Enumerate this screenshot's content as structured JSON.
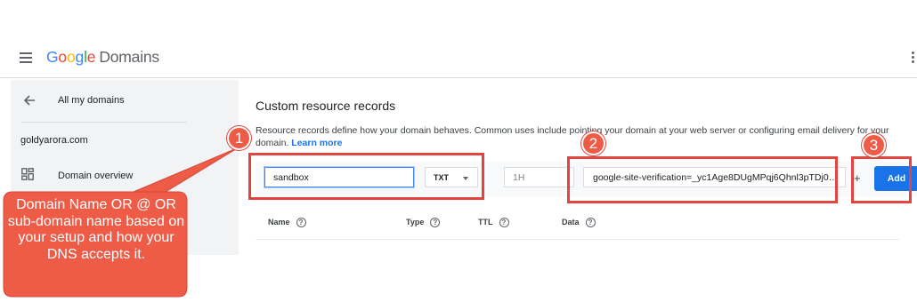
{
  "header": {
    "logo_letters": [
      "G",
      "o",
      "o",
      "g",
      "l",
      "e"
    ],
    "logo_product": "Domains"
  },
  "sidebar": {
    "back_label": "All my domains",
    "domain": "goldyarora.com",
    "nav_item": "Domain overview"
  },
  "main": {
    "title": "Custom resource records",
    "description": "Resource records define how your domain behaves. Common uses include pointing your domain at your web server or configuring email delivery for your domain.",
    "learn_more": "Learn more",
    "form": {
      "name_value": "sandbox",
      "type_value": "TXT",
      "ttl_placeholder": "1H",
      "data_value": "google-site-verification=_yc1Age8DUgMPqj6Qhnl3pTDj0…",
      "plus": "+",
      "add_label": "Add"
    },
    "table_headers": [
      "Name",
      "Type",
      "TTL",
      "Data"
    ],
    "help_glyph": "?"
  },
  "annotations": {
    "badges": [
      "1",
      "2",
      "3"
    ],
    "callout": "Domain Name OR @ OR sub-domain name based on your setup and how your DNS accepts it.",
    "highlight_color": "#e0453f",
    "callout_color": "#ee5b47"
  },
  "colors": {
    "accent": "#1a73e8",
    "sidebar_bg": "#f1f3f4"
  }
}
